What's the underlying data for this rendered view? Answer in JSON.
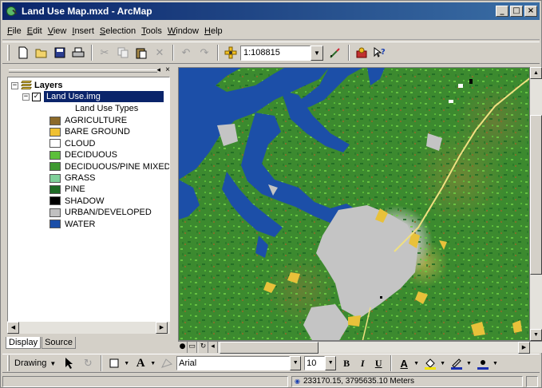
{
  "window": {
    "title": "Land Use Map.mxd - ArcMap",
    "minimize": "_",
    "maximize": "□",
    "close": "×"
  },
  "menu": [
    "File",
    "Edit",
    "View",
    "Insert",
    "Selection",
    "Tools",
    "Window",
    "Help"
  ],
  "toolbar": {
    "scale_value": "1:108815",
    "icons": [
      "new-icon",
      "open-icon",
      "save-icon",
      "print-icon",
      "cut-icon",
      "copy-icon",
      "paste-icon",
      "delete-icon",
      "undo-icon",
      "redo-icon",
      "add-data-icon",
      "editor-icon",
      "arctoolbox-icon",
      "whats-this-icon"
    ]
  },
  "toc": {
    "root_label": "Layers",
    "layer_label": "Land Use.img",
    "legend_heading": "Land Use Types",
    "legend": [
      {
        "label": "AGRICULTURE",
        "color": "#8c6a2a"
      },
      {
        "label": "BARE GROUND",
        "color": "#f0c030"
      },
      {
        "label": "CLOUD",
        "color": "#ffffff"
      },
      {
        "label": "DECIDUOUS",
        "color": "#5cbf3a"
      },
      {
        "label": "DECIDUOUS/PINE MIXED",
        "color": "#3e9a30"
      },
      {
        "label": "GRASS",
        "color": "#7fd09a"
      },
      {
        "label": "PINE",
        "color": "#1e6b26"
      },
      {
        "label": "SHADOW",
        "color": "#000000"
      },
      {
        "label": "URBAN/DEVELOPED",
        "color": "#c0c0c0"
      },
      {
        "label": "WATER",
        "color": "#1c4fa8"
      }
    ],
    "tabs": [
      "Display",
      "Source"
    ]
  },
  "drawing": {
    "menu_label": "Drawing",
    "font_name": "Arial",
    "font_size": "10",
    "bold": "B",
    "italic": "I",
    "underline": "U"
  },
  "status": {
    "coordinates": "233170.15, 3795635.10 Meters"
  },
  "colors": {
    "title_bar": "#0a246a",
    "water": "#1c4fa8",
    "urban": "#c0c0c0",
    "forest": "#3c8a2f"
  }
}
